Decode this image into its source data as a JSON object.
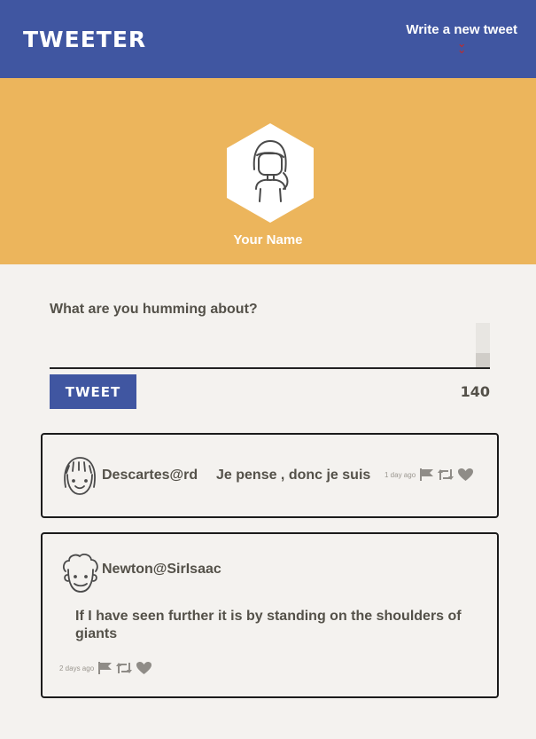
{
  "navbar": {
    "brand": "TWEETER",
    "compose_label": "Write a new tweet",
    "compose_icon": "double-chevron-down-icon"
  },
  "profile": {
    "name": "Your Name",
    "avatar_icon": "avatar-girl-icon"
  },
  "compose": {
    "prompt": "What are you humming about?",
    "button_label": "TWEET",
    "char_count": "140"
  },
  "tweets": [
    {
      "handle": "Descartes@rd",
      "text": "Je pense , donc je suis",
      "age": "1 day ago",
      "avatar_icon": "avatar-bangs-icon"
    },
    {
      "handle": "Newton@SirIsaac",
      "text": "If I have seen further it is by standing on the shoulders of giants",
      "age": "2 days ago",
      "avatar_icon": "avatar-curly-icon"
    }
  ],
  "actions": [
    "flag-icon",
    "retweet-icon",
    "heart-icon"
  ],
  "colors": {
    "navbar": "#4056a1",
    "profile_bg": "#ecb55c",
    "page_bg": "#f4f2ef",
    "accent_red": "#c02b2b",
    "text": "#545149"
  }
}
